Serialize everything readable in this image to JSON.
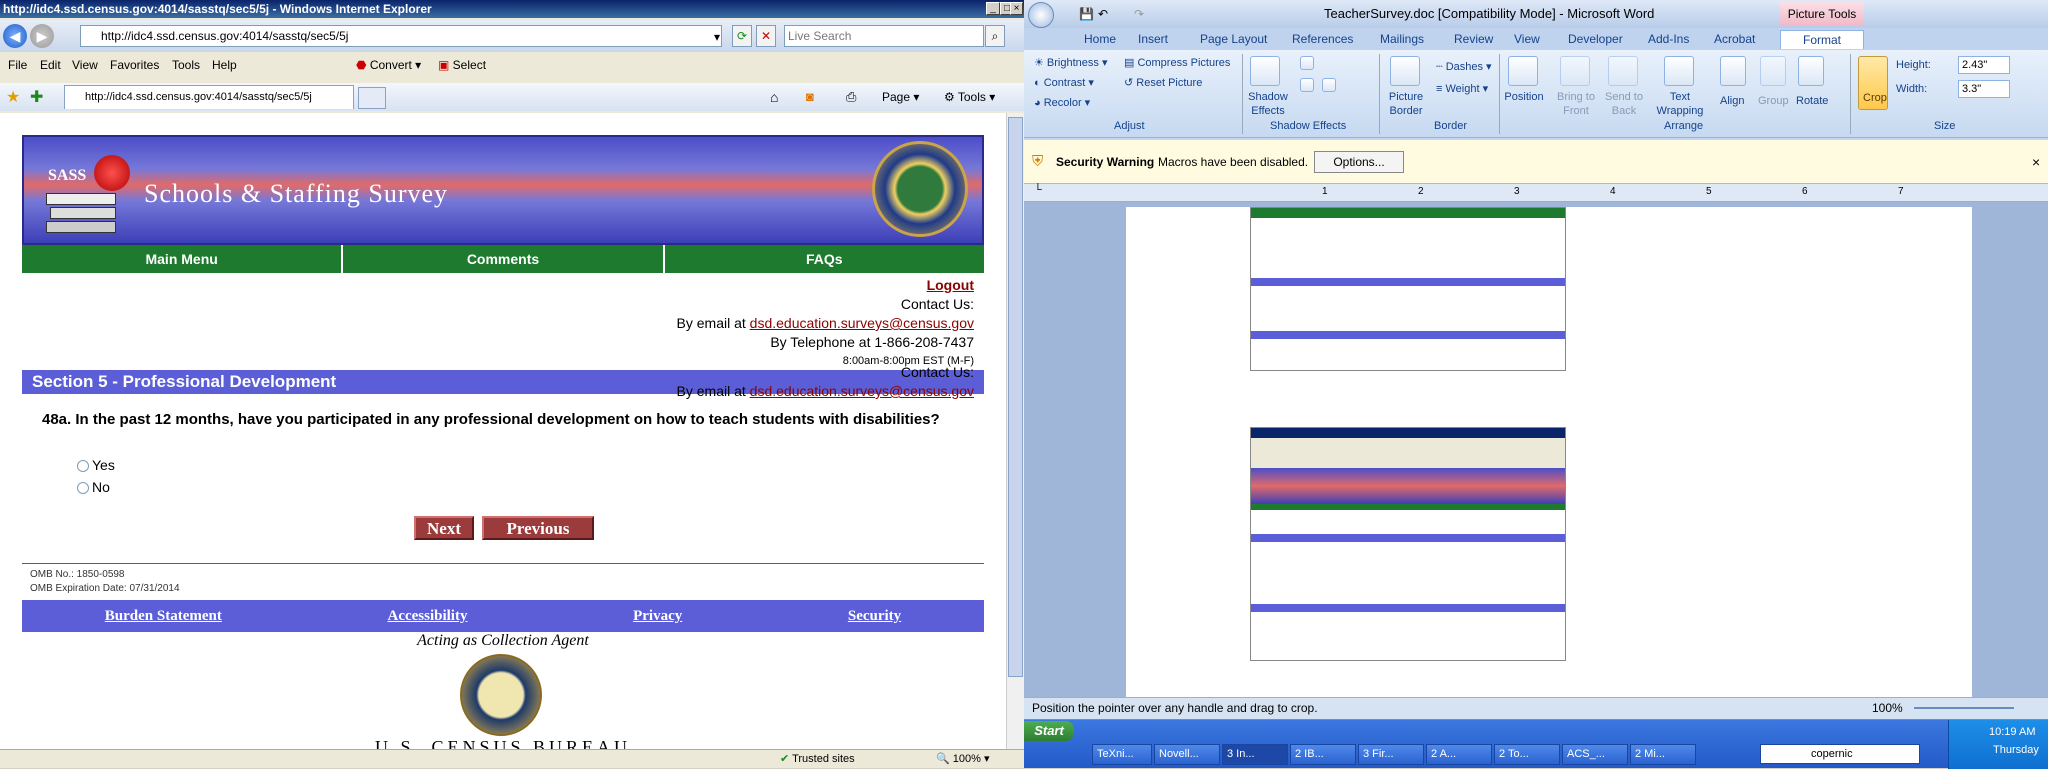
{
  "ie": {
    "title": "http://idc4.ssd.census.gov:4014/sasstq/sec5/5j - Windows Internet Explorer",
    "address": "http://idc4.ssd.census.gov:4014/sasstq/sec5/5j",
    "search_placeholder": "Live Search",
    "menu": [
      "File",
      "Edit",
      "View",
      "Favorites",
      "Tools",
      "Help"
    ],
    "convert": "Convert",
    "select": "Select",
    "tab_title": "http://idc4.ssd.census.gov:4014/sasstq/sec5/5j",
    "toolbar_right": {
      "page": "Page",
      "tools": "Tools"
    },
    "status_zone": "Trusted sites",
    "zoom": "100%"
  },
  "survey": {
    "logo_text": "SASS",
    "title": "Schools & Staffing Survey",
    "seal_text": "DEPARTMENT OF EDUCATION · UNITED STATES OF AMERICA",
    "nav": [
      "Main Menu",
      "Comments",
      "FAQs"
    ],
    "logout": "Logout",
    "contact_us": "Contact Us:",
    "email_prefix": "By email at",
    "email": "dsd.education.surveys@census.gov",
    "phone": "By Telephone at 1-866-208-7437",
    "hours": "8:00am-8:00pm EST (M-F)",
    "section": "Section 5 - Professional Development",
    "question": "48a. In the past 12 months, have you participated in any professional development on how to teach students with disabilities?",
    "options": [
      "Yes",
      "No"
    ],
    "next": "Next",
    "previous": "Previous",
    "omb_no": "OMB No.: 1850-0598",
    "omb_exp": "OMB Expiration Date: 07/31/2014",
    "footer_links": [
      "Burden Statement",
      "Accessibility",
      "Privacy",
      "Security"
    ],
    "agent": "Acting as Collection Agent",
    "census_text": "U.S. CENSUS BUREAU"
  },
  "word": {
    "title": "TeacherSurvey.doc [Compatibility Mode] - Microsoft Word",
    "context_tab": "Picture Tools",
    "tabs": [
      "Home",
      "Insert",
      "Page Layout",
      "References",
      "Mailings",
      "Review",
      "View",
      "Developer",
      "Add-Ins",
      "Acrobat",
      "Format"
    ],
    "adjust": {
      "brightness": "Brightness",
      "contrast": "Contrast",
      "recolor": "Recolor",
      "compress": "Compress Pictures",
      "reset": "Reset Picture",
      "label": "Adjust"
    },
    "shadow": {
      "button": "Shadow Effects",
      "label": "Shadow Effects"
    },
    "border": {
      "picture_border": "Picture Border",
      "dashes": "Dashes",
      "weight": "Weight",
      "label": "Border"
    },
    "arrange": {
      "position": "Position",
      "bring": "Bring to Front",
      "send": "Send to Back",
      "wrap": "Text Wrapping",
      "align": "Align",
      "group": "Group",
      "rotate": "Rotate",
      "label": "Arrange"
    },
    "size": {
      "crop": "Crop",
      "height_label": "Height:",
      "height": "2.43\"",
      "width_label": "Width:",
      "width": "3.3\"",
      "label": "Size"
    },
    "security_warning": "Security Warning",
    "macros_msg": "Macros have been disabled.",
    "options": "Options...",
    "ruler_marks": [
      "1",
      "2",
      "3",
      "4",
      "5",
      "6",
      "7"
    ],
    "status_msg": "Position the pointer over any handle and drag to crop.",
    "zoom": "100%"
  },
  "taskbar": {
    "start": "Start",
    "items": [
      "TeXni...",
      "Novell...",
      "3 In...",
      "2 IB...",
      "3 Fir...",
      "2 A...",
      "2 To...",
      "ACS_...",
      "2 Mi..."
    ],
    "search_text": "copernic",
    "time": "10:19 AM",
    "day": "Thursday"
  }
}
